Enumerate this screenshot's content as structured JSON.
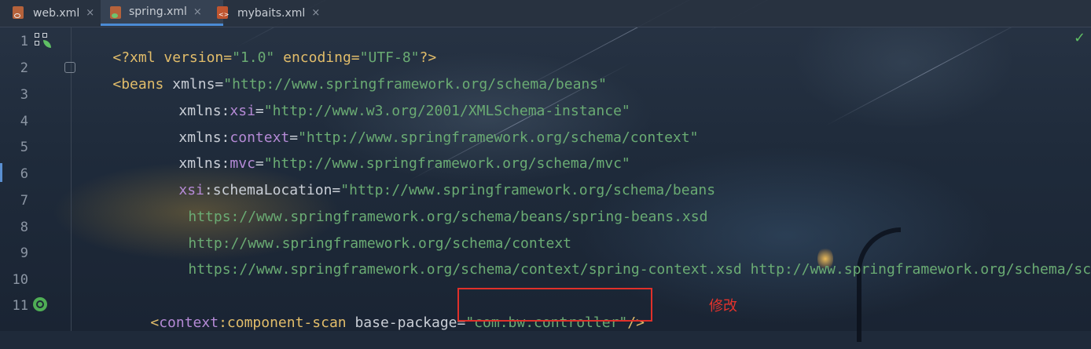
{
  "tabs": [
    {
      "label": "web.xml",
      "close": "×",
      "icon": "xml-file-icon",
      "active": false
    },
    {
      "label": "spring.xml",
      "close": "×",
      "icon": "spring-xml-file-icon",
      "active": true
    },
    {
      "label": "mybaits.xml",
      "close": "×",
      "icon": "xml-code-file-icon",
      "active": false
    }
  ],
  "line_numbers": [
    "1",
    "2",
    "3",
    "4",
    "5",
    "6",
    "7",
    "8",
    "9",
    "10",
    "11"
  ],
  "code": {
    "l1": {
      "a": "<?xml version=",
      "b": "\"1.0\"",
      "c": " encoding=",
      "d": "\"UTF-8\"",
      "e": "?>"
    },
    "l2": {
      "a": "<beans",
      "b": " xmlns=",
      "c": "\"http://www.springframework.org/schema/beans\""
    },
    "l3": {
      "a": "xmlns:",
      "b": "xsi",
      "c": "=",
      "d": "\"http://www.w3.org/2001/XMLSchema-instance\""
    },
    "l4": {
      "a": "xmlns:",
      "b": "context",
      "c": "=",
      "d": "\"http://www.springframework.org/schema/context\""
    },
    "l5": {
      "a": "xmlns:",
      "b": "mvc",
      "c": "=",
      "d": "\"http://www.springframework.org/schema/mvc\""
    },
    "l6": {
      "a": "xsi",
      "b": ":schemaLocation=",
      "c": "\"http://www.springframework.org/schema/beans"
    },
    "l7": {
      "a": "https://www.springframework.org/schema/beans/spring-beans.xsd"
    },
    "l8": {
      "a": "http://www.springframework.org/schema/context"
    },
    "l9": {
      "a": "https://www.springframework.org/schema/context/spring-context.xsd http://www.springframework.org/schema/sch"
    },
    "l11": {
      "a": "<",
      "b": "context",
      "c": ":component-scan",
      "d": " base-package=",
      "e": "\"com.bw.controller\"",
      "f": "/>"
    }
  },
  "annotation": {
    "note": "修改"
  },
  "status": {
    "check": "✓"
  },
  "colors": {
    "tag": "#e2bd6a",
    "namespace": "#b58ad6",
    "string": "#6aab73",
    "highlight_box": "#e0302a",
    "active_tab_underline": "#4b8bd5"
  }
}
